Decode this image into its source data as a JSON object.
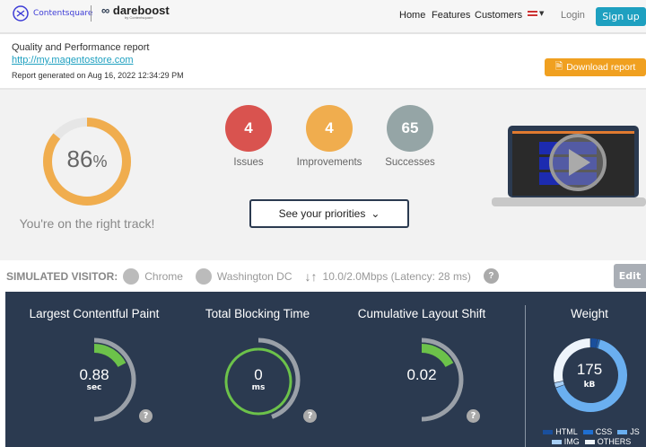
{
  "header": {
    "brand1": "Contentsquare",
    "brand2": "dareboost",
    "brand2_sub": "by Contentsquare",
    "nav": [
      "Home",
      "Features",
      "Customers"
    ],
    "login": "Login",
    "signup": "Sign up"
  },
  "report": {
    "title": "Quality and Performance report",
    "url": "http://my.magentostore.com",
    "generated": "Report generated on Aug 16, 2022 12:34:29 PM",
    "download": "Download report"
  },
  "summary": {
    "score": "86",
    "score_unit": "%",
    "score_pct": 86,
    "message": "You're on the right track!",
    "counts": [
      {
        "value": "4",
        "label": "Issues",
        "color": "#d9534f"
      },
      {
        "value": "4",
        "label": "Improvements",
        "color": "#f0ad4e"
      },
      {
        "value": "65",
        "label": "Successes",
        "color": "#95a5a6"
      }
    ],
    "priorities": "See your priorities"
  },
  "visitor": {
    "label": "SIMULATED VISITOR:",
    "browser": "Chrome",
    "location": "Washington DC",
    "network": "10.0/2.0Mbps (Latency: 28 ms)",
    "edit": "Edit"
  },
  "metrics": [
    {
      "title": "Largest Contentful Paint",
      "value": "0.88",
      "unit": "sec"
    },
    {
      "title": "Total Blocking Time",
      "value": "0",
      "unit": "ms"
    },
    {
      "title": "Cumulative Layout Shift",
      "value": "0.02",
      "unit": ""
    }
  ],
  "weight": {
    "title": "Weight",
    "value": "175",
    "unit": "kB",
    "legend": [
      {
        "name": "HTML",
        "color": "#1a4f9c"
      },
      {
        "name": "CSS",
        "color": "#1f6fd1"
      },
      {
        "name": "JS",
        "color": "#6aaff0"
      },
      {
        "name": "IMG",
        "color": "#a8cff5"
      },
      {
        "name": "OTHERS",
        "color": "#eef4fb"
      }
    ]
  },
  "colors": {
    "panel": "#2b3a50",
    "good": "#6cc24a",
    "accent": "#f0ad4e"
  }
}
